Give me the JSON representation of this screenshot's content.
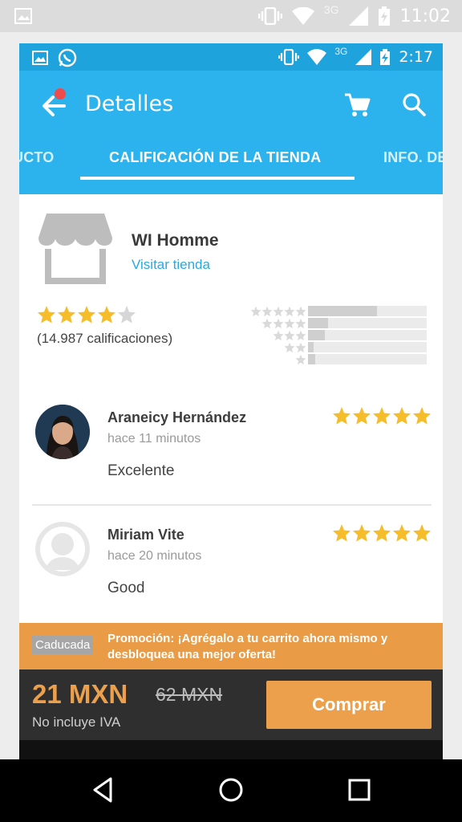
{
  "outer_status": {
    "time": "11:02",
    "network": "3G"
  },
  "inner_status": {
    "time": "2:17",
    "network": "3G"
  },
  "appbar": {
    "title": "Detalles"
  },
  "tabs": [
    {
      "label": "UCTO"
    },
    {
      "label": "CALIFICACIÓN DE LA TIENDA"
    },
    {
      "label": "INFO. DE"
    }
  ],
  "store": {
    "name": "WI Homme",
    "link": "Visitar tienda",
    "rating_value": 4,
    "rating_max": 5,
    "rating_count": "(14.987 calificaciones)",
    "distribution": [
      {
        "stars": 5,
        "fraction": 0.58
      },
      {
        "stars": 4,
        "fraction": 0.17
      },
      {
        "stars": 3,
        "fraction": 0.14
      },
      {
        "stars": 2,
        "fraction": 0.05
      },
      {
        "stars": 1,
        "fraction": 0.06
      }
    ]
  },
  "reviews": [
    {
      "name": "Araneicy Hernández",
      "time": "hace 11 minutos",
      "text": "Excelente",
      "rating": 5
    },
    {
      "name": "Miriam Vite",
      "time": "hace 20 minutos",
      "text": "Good",
      "rating": 5
    }
  ],
  "promo": {
    "badge": "Caducada",
    "text": "Promoción: ¡Agrégalo a tu carrito ahora mismo y desbloquea una mejor oferta!"
  },
  "buy": {
    "price": "21 MXN",
    "old_price": "62 MXN",
    "tax_note": "No incluye IVA",
    "button": "Comprar"
  },
  "colors": {
    "primary": "#2cb2ec",
    "accent": "#eca04c",
    "star": "#f6bd2b",
    "promo": "#e99b45"
  }
}
